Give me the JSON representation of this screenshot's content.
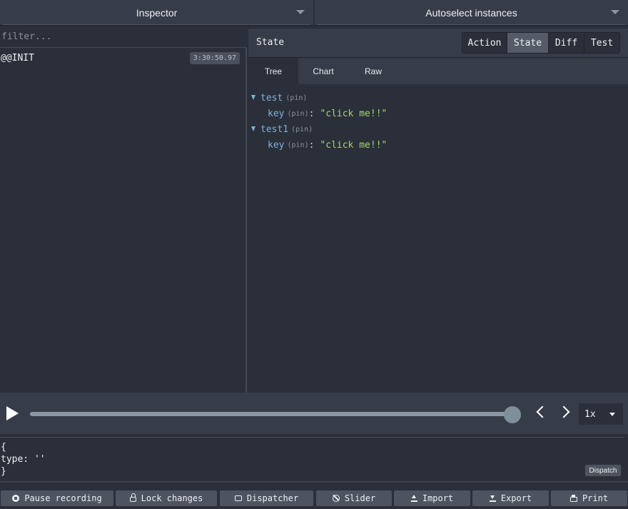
{
  "topbar": {
    "left_select": "Inspector",
    "right_select": "Autoselect instances"
  },
  "actions": {
    "filter_placeholder": "filter...",
    "items": [
      {
        "name": "@@INIT",
        "time": "3:30:50.97"
      }
    ]
  },
  "monitor": {
    "title": "State",
    "segments": [
      "Action",
      "State",
      "Diff",
      "Test"
    ],
    "active_segment": "State",
    "tabs": [
      "Tree",
      "Chart",
      "Raw"
    ],
    "active_tab": "Tree"
  },
  "tree": {
    "pin_label": "(pin)",
    "nodes": [
      {
        "key": "test",
        "child_key": "key",
        "child_value": "\"click me!!\""
      },
      {
        "key": "test1",
        "child_key": "key",
        "child_value": "\"click me!!\""
      }
    ]
  },
  "slider": {
    "position": 1.0,
    "speed": "1x"
  },
  "dispatcher": {
    "code": "{\ntype: ''\n}",
    "button": "Dispatch"
  },
  "toolbar": {
    "pause": "Pause recording",
    "lock": "Lock changes",
    "dispatcher": "Dispatcher",
    "slider": "Slider",
    "import": "Import",
    "export": "Export",
    "print": "Print"
  },
  "colors": {
    "background": "#2a2f3a",
    "panel": "#363c48",
    "key": "#7fb2d6",
    "string": "#a6d56b"
  }
}
